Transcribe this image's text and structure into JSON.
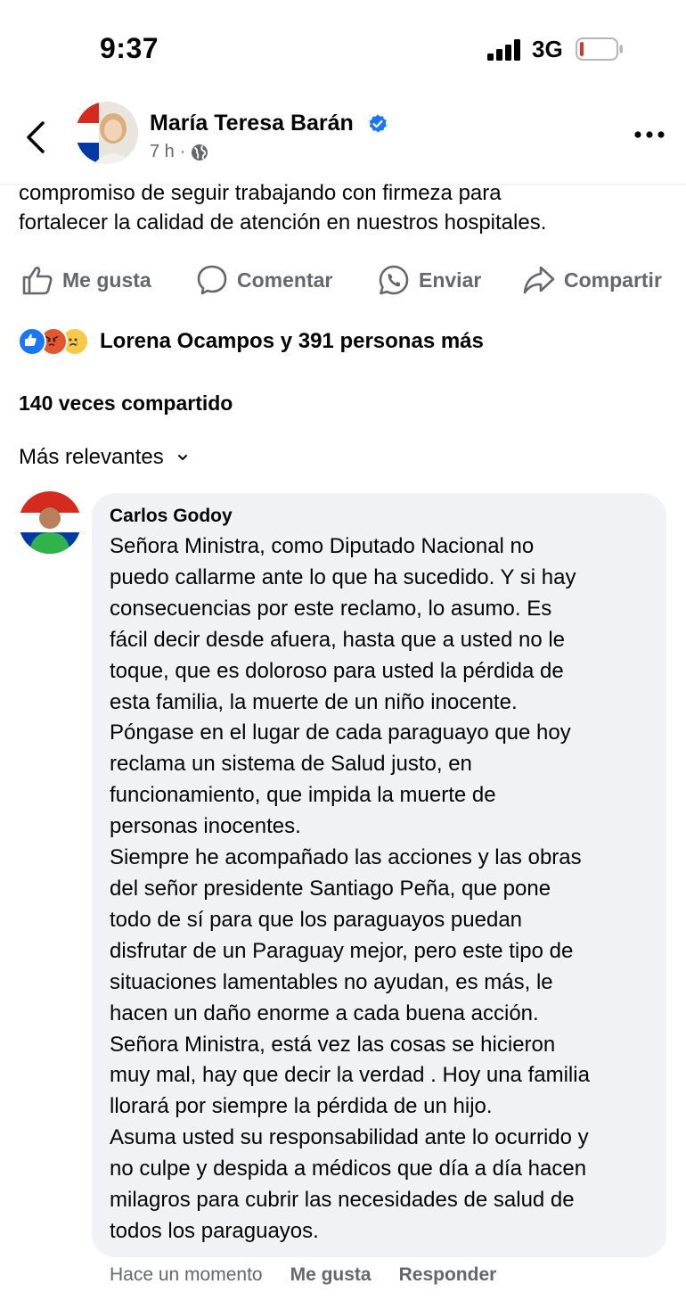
{
  "status_bar": {
    "time": "9:37",
    "network": "3G",
    "battery_icon": "battery-low-icon",
    "battery_color": "#e5312b"
  },
  "header": {
    "back_icon": "chevron-left-icon",
    "poster_name": "María Teresa Barán",
    "verified_icon": "verified-badge-icon",
    "time_ago": "7 h",
    "separator": "·",
    "audience_icon": "globe-icon",
    "more_icon": "more-horizontal-icon"
  },
  "post": {
    "text_line_1": "compromiso de seguir trabajando con firmeza para",
    "text_line_2": "fortalecer la calidad de atención en nuestros hospitales."
  },
  "actions": {
    "like": "Me gusta",
    "comment": "Comentar",
    "send": "Enviar",
    "share": "Compartir"
  },
  "reactions": {
    "icons": [
      "like-reaction-icon",
      "angry-reaction-icon",
      "sad-reaction-icon"
    ],
    "summary": "Lorena Ocampos y 391 personas más"
  },
  "shares": "140 veces compartido",
  "sort": {
    "label": "Más relevantes",
    "icon": "chevron-down-icon"
  },
  "comment": {
    "author": "Carlos Godoy",
    "text": "Señora Ministra, como Diputado Nacional no\npuedo callarme ante lo que ha sucedido. Y si hay\nconsecuencias por este reclamo, lo asumo. Es\nfácil decir desde afuera, hasta que a usted no le\ntoque, que es doloroso para usted la pérdida de\nesta familia, la muerte de un niño inocente.\nPóngase en el lugar de cada paraguayo que hoy\nreclama un sistema de Salud justo, en\nfuncionamiento, que impida la muerte de\npersonas inocentes.\nSiempre he acompañado las acciones y las obras\ndel señor presidente Santiago Peña, que pone\ntodo de sí para que los paraguayos puedan\ndisfrutar de un Paraguay mejor, pero este tipo de\nsituaciones lamentables no ayudan, es más, le\nhacen un daño enorme a cada buena acción.\nSeñora Ministra, está vez las cosas se hicieron\nmuy mal, hay que decir la verdad . Hoy una familia\nllorará por siempre la pérdida de un hijo.\nAsuma usted su responsabilidad ante lo ocurrido y\nno culpe y despida a médicos que día a día hacen\nmilagros para cubrir las necesidades de salud de\ntodos los paraguayos.",
    "time": "Hace un momento",
    "like": "Me gusta",
    "reply": "Responder"
  },
  "colors": {
    "verified_blue": "#1877f2",
    "like_blue": "#1877f2",
    "angry_red": "#e4572e",
    "sad_yellow": "#f7c948",
    "secondary_text": "#65676b",
    "bubble_bg": "#f0f2f5"
  }
}
